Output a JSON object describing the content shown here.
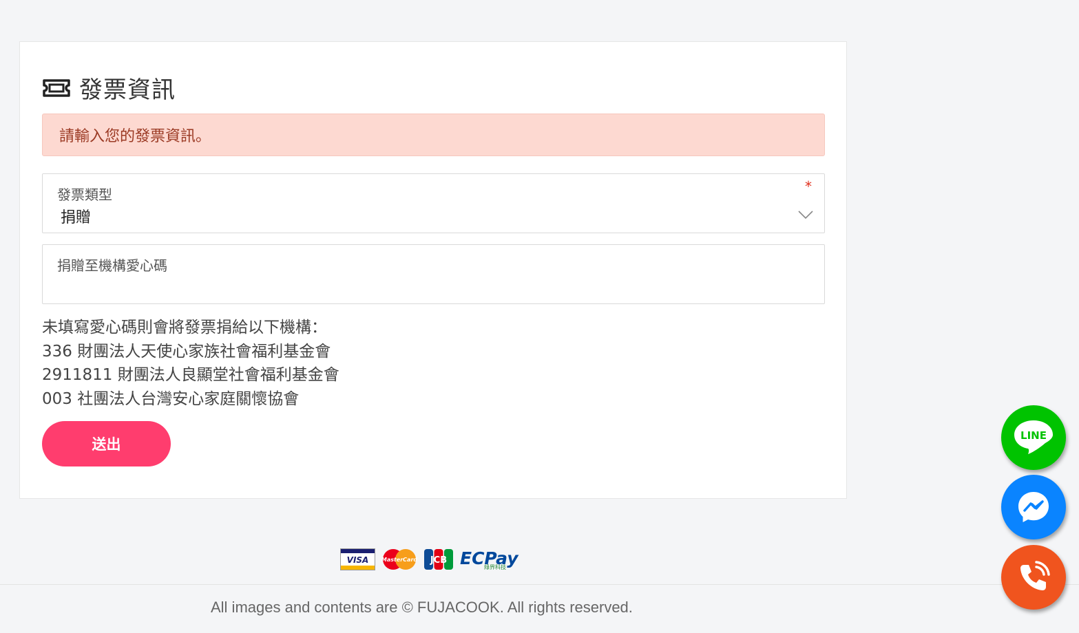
{
  "page": {
    "title": "發票資訊",
    "title_icon": "ticket-icon",
    "alert": "請輸入您的發票資訊。"
  },
  "form": {
    "invoice_type": {
      "label": "發票類型",
      "required_mark": "*",
      "value": "捐贈",
      "icon": "chevron-down-icon"
    },
    "donation_code": {
      "label": "捐贈至機構愛心碼",
      "value": ""
    },
    "info_lines": [
      "未填寫愛心碼則會將發票捐給以下機構：",
      "336 財團法人天使心家族社會福利基金會",
      "2911811 財團法人良顯堂社會福利基金會",
      "003 社團法人台灣安心家庭關懷協會"
    ],
    "submit_label": "送出"
  },
  "footer": {
    "payment_logos": [
      "VISA",
      "MasterCard",
      "JCB",
      "ECPay",
      "綠界科技"
    ],
    "copyright": "All images and contents are © FUJACOOK. All rights reserved."
  },
  "floating": {
    "line_label": "LINE",
    "colors": {
      "line": "#00c300",
      "messenger": "#0a84ff",
      "phone": "#f0541e",
      "submit": "#ff3d6e",
      "alert_bg": "#fdd9d1"
    }
  }
}
